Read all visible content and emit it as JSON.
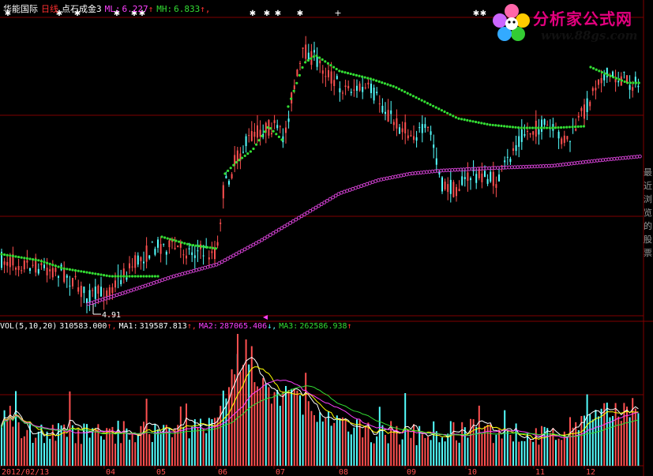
{
  "header": {
    "stock_name": "华能国际",
    "period": "日线",
    "indicator": "点石成金3",
    "ml_label": "ML:",
    "ml_value": "6.227",
    "ml_arrow": "↑",
    "mh_label": "MH:",
    "mh_value": "6.833",
    "mh_arrow": "↑,"
  },
  "volume_header": {
    "name": "VOL(5,10,20)",
    "value": "310583.000",
    "value_arrow": "↑,",
    "ma1_label": "MA1:",
    "ma1_value": "319587.813",
    "ma1_arrow": "↑,",
    "ma2_label": "MA2:",
    "ma2_value": "287065.406",
    "ma2_arrow": "↓,",
    "ma3_label": "MA3:",
    "ma3_value": "262586.938",
    "ma3_arrow": "↑"
  },
  "logo": {
    "name": "分析家公式网",
    "url": "www.88gs.com"
  },
  "side_text": "最近浏览的股票",
  "colors": {
    "background": "#000000",
    "grid": "#800000",
    "up_candle": "#ff5050",
    "down_candle": "#54ffff",
    "ml_line": "#33dd33",
    "mh_line": "#d040d0",
    "label_magenta": "#ff40ff",
    "label_green": "#33dd33",
    "text_white": "#ffffff",
    "text_red": "#ff3030",
    "vol_ma1": "#ffffff",
    "vol_ma2": "#ffff00",
    "vol_ma3": "#ff40ff",
    "vol_ma4": "#33dd33"
  },
  "chart_data": {
    "type": "candlestick",
    "price_low_label": "4.91",
    "x_axis_labels": [
      "2012/02/13",
      "04",
      "05",
      "06",
      "07",
      "08",
      "09",
      "10",
      "11",
      "12"
    ],
    "price_range": [
      4.7,
      7.45
    ],
    "volume_range": [
      0,
      1000000
    ],
    "ml_series_value": 6.227,
    "mh_series_value": 6.833,
    "volume_last": 310583.0,
    "ma1_last": 319587.813,
    "ma2_last": 287065.406,
    "ma3_last": 262586.938
  }
}
